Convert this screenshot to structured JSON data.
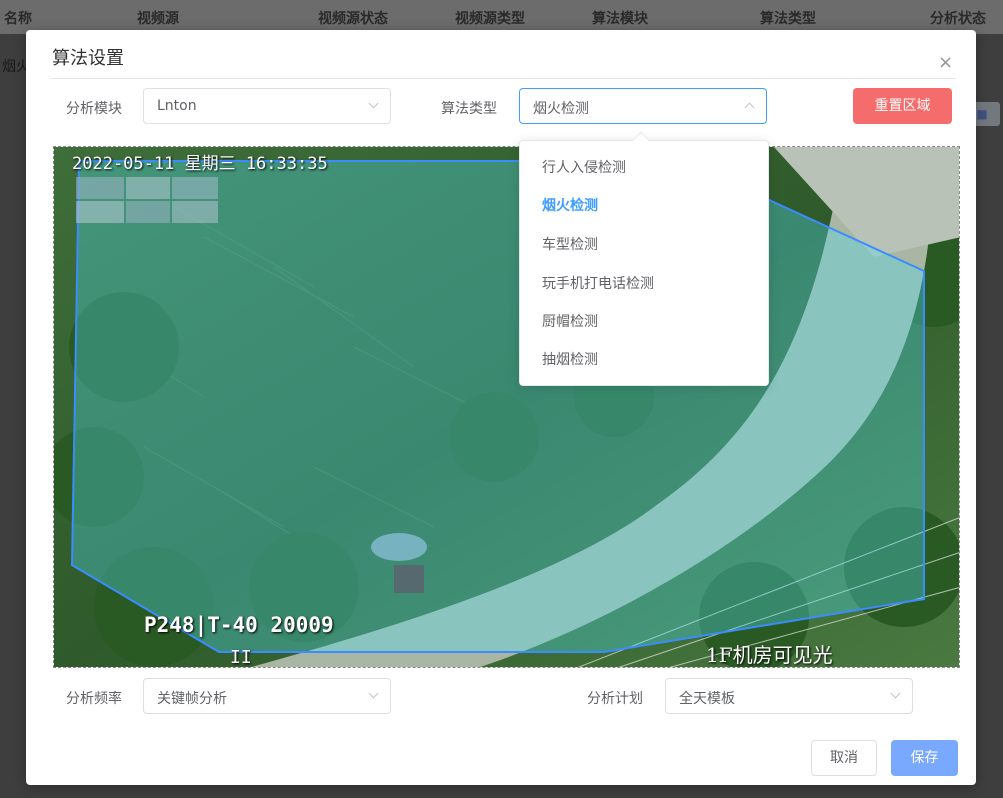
{
  "bg_table": {
    "headers": [
      "名称",
      "视频源",
      "视频源状态",
      "视频源类型",
      "算法模块",
      "算法类型",
      "分析状态"
    ],
    "row_first_cell": "烟火",
    "row_action": "■"
  },
  "dialog": {
    "title": "算法设置",
    "close_icon": "×",
    "module_label": "分析模块",
    "module_value": "Lnton",
    "algo_type_label": "算法类型",
    "algo_type_value": "烟火检测",
    "reset_button": "重置区域",
    "frequency_label": "分析频率",
    "frequency_value": "关键帧分析",
    "schedule_label": "分析计划",
    "schedule_value": "全天模板",
    "cancel_button": "取消",
    "save_button": "保存"
  },
  "algo_options": [
    {
      "label": "行人入侵检测",
      "selected": false
    },
    {
      "label": "烟火检测",
      "selected": true
    },
    {
      "label": "车型检测",
      "selected": false
    },
    {
      "label": "玩手机打电话检测",
      "selected": false
    },
    {
      "label": "厨帽检测",
      "selected": false
    },
    {
      "label": "抽烟检测",
      "selected": false
    }
  ],
  "video": {
    "timestamp": "2022-05-11 星期三 16:33:35",
    "camera_code": "P248|T-40  20009",
    "location": "1F机房可见光",
    "bottom_mark": "II"
  },
  "colors": {
    "primary": "#409eff",
    "danger": "#f56c6c",
    "region_fill": "#4fe0f0",
    "region_stroke": "#3a8cff"
  }
}
